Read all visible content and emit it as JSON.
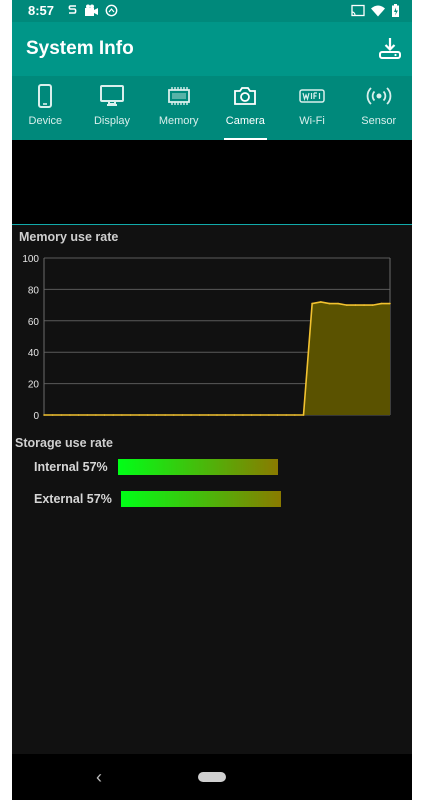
{
  "status": {
    "time": "8:57"
  },
  "app": {
    "title": "System Info",
    "download_icon": "download-icon"
  },
  "tabs": [
    {
      "label": "Device",
      "icon": "phone-icon"
    },
    {
      "label": "Display",
      "icon": "monitor-icon"
    },
    {
      "label": "Memory",
      "icon": "memory-chip-icon"
    },
    {
      "label": "Camera",
      "icon": "camera-icon",
      "active": true
    },
    {
      "label": "Wi-Fi",
      "icon": "wifi-icon"
    },
    {
      "label": "Sensor",
      "icon": "sensor-icon"
    }
  ],
  "memory": {
    "title": "Memory use rate",
    "chart_data": {
      "type": "area",
      "title": "Memory use rate",
      "ylim": [
        0,
        100
      ],
      "yticks": [
        0,
        20,
        40,
        60,
        80,
        100
      ],
      "x": [
        0,
        1,
        2,
        3,
        4,
        5,
        6,
        7,
        8,
        9,
        10,
        11,
        12,
        13,
        14,
        15,
        16,
        17,
        18,
        19,
        20,
        21,
        22,
        23,
        24,
        25,
        26,
        27,
        28,
        29,
        30,
        31,
        32,
        33,
        34,
        35,
        36,
        37,
        38,
        39,
        40
      ],
      "values": [
        0,
        0,
        0,
        0,
        0,
        0,
        0,
        0,
        0,
        0,
        0,
        0,
        0,
        0,
        0,
        0,
        0,
        0,
        0,
        0,
        0,
        0,
        0,
        0,
        0,
        0,
        0,
        0,
        0,
        0,
        0,
        71,
        72,
        71,
        71,
        70,
        70,
        70,
        70,
        71,
        71
      ],
      "color": "#f2c230",
      "fill": "#5a5200",
      "grid": true
    }
  },
  "storage": {
    "title": "Storage use rate",
    "internal": {
      "label": "Internal  57%",
      "percent": 57
    },
    "external": {
      "label": "External  57%",
      "percent": 57
    }
  },
  "colors": {
    "primary": "#009688",
    "background": "#111111"
  }
}
